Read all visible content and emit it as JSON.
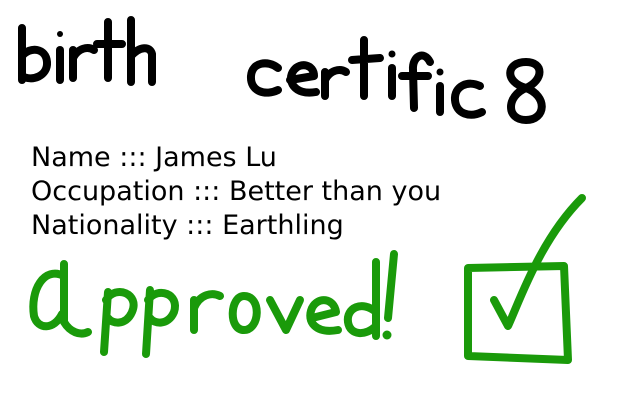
{
  "title": "birth certific8",
  "fields": [
    {
      "label": "Name",
      "separator": ":::",
      "value": "James Lu"
    },
    {
      "label": "Occupation",
      "separator": ":::",
      "value": "Better than you"
    },
    {
      "label": "Nationality",
      "separator": ":::",
      "value": "Earthling"
    }
  ],
  "stamp": "Approved!",
  "colors": {
    "ink": "#000000",
    "approval": "#1a9a0a",
    "background": "#ffffff"
  }
}
